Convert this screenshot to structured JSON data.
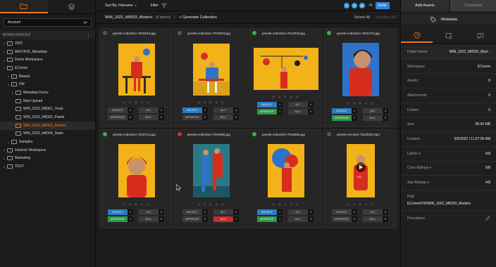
{
  "sidebar": {
    "account_label": "Account",
    "workspaces_header": "WORKSPACES",
    "tree": [
      {
        "label": "2022",
        "depth": 0,
        "arrow": "▸"
      },
      {
        "label": "ARCHIVE_Metadata",
        "depth": 0,
        "arrow": "▸"
      },
      {
        "label": "Demo Workspace",
        "depth": 0,
        "arrow": "▸"
      },
      {
        "label": "EComm",
        "depth": 0,
        "arrow": "▾"
      },
      {
        "label": "Beauty",
        "depth": 1,
        "arrow": "▸"
      },
      {
        "label": "FW",
        "depth": 1,
        "arrow": "▾"
      },
      {
        "label": "Metadata Demo",
        "depth": 2,
        "arrow": "▸"
      },
      {
        "label": "New Upload",
        "depth": 2,
        "arrow": ""
      },
      {
        "label": "WIN_2022_M8301_Tonal",
        "depth": 2,
        "arrow": ""
      },
      {
        "label": "WIN_2022_M8302_Pastel",
        "depth": 2,
        "arrow": ""
      },
      {
        "label": "WIN_2022_M8303_Modern",
        "depth": 2,
        "arrow": "",
        "selected": true
      },
      {
        "label": "WIN_2022_M8304_Swim",
        "depth": 2,
        "arrow": ""
      },
      {
        "label": "Samples",
        "depth": 1,
        "arrow": "▸"
      },
      {
        "label": "Interiors Workspace",
        "depth": 0,
        "arrow": "▸"
      },
      {
        "label": "Marketing",
        "depth": 0,
        "arrow": "▸"
      },
      {
        "label": "TEST",
        "depth": 0,
        "arrow": "▸"
      }
    ]
  },
  "toolbar": {
    "sort_label": "Sort By: Filename",
    "filter_label": "Filter"
  },
  "collection": {
    "name": "WIN_2022_M8303_Modern",
    "count": "(8 items)",
    "generate": "+ Generate Collection",
    "select_all": "Select All",
    "deselect_all": "Deselect All"
  },
  "labels": {
    "select": "SELECT",
    "alt": "ALT",
    "approve": "APPROVE",
    "kill": "KILL"
  },
  "cards": [
    {
      "filename": "pexels-cottonbro-7510010.jpg",
      "dot": "#555555",
      "select": "0",
      "alt": "0",
      "approve": "0",
      "kill": "0",
      "active": []
    },
    {
      "filename": "pexels-cottonbro-7510023.jpg",
      "dot": "#555555",
      "select": "1",
      "alt": "0",
      "approve": "0",
      "kill": "0",
      "active": [
        "select"
      ]
    },
    {
      "filename": "pexels-cottonbro-7510026.jpg",
      "dot": "#3fae4a",
      "select": "1",
      "alt": "0",
      "approve": "1",
      "kill": "0",
      "active": [
        "select",
        "approve"
      ]
    },
    {
      "filename": "pexels-cottonbro-7515724.jpg",
      "dot": "#3fae4a",
      "select": "1",
      "alt": "0",
      "approve": "1",
      "kill": "0",
      "active": [
        "select",
        "approve"
      ]
    },
    {
      "filename": "pexels-cottonbro-7515731.jpg",
      "dot": "#3fae4a",
      "select": "1",
      "alt": "0",
      "approve": "1",
      "kill": "0",
      "active": [
        "select",
        "approve"
      ]
    },
    {
      "filename": "pexels-cottonbro-7516565.jpg",
      "dot": "#d03232",
      "select": "0",
      "alt": "0",
      "approve": "0",
      "kill": "1",
      "active": [
        "kill"
      ]
    },
    {
      "filename": "pexels-cottonbro-7516566.jpg",
      "dot": "#3fae4a",
      "select": "1",
      "alt": "0",
      "approve": "1",
      "kill": "0",
      "active": [
        "select",
        "approve"
      ]
    },
    {
      "filename": "pexels-ron-lach-7510038.mp4",
      "dot": "#555555",
      "select": "0",
      "alt": "0",
      "approve": "0",
      "kill": "0",
      "active": [],
      "video_badge": "100"
    }
  ],
  "topbar": {
    "avatars": [
      "T",
      "F",
      "R"
    ],
    "more": "+5",
    "invite": "Invite",
    "add_assets": "Add Assets",
    "download": "Download"
  },
  "metadata": {
    "title": "Metadata",
    "rows": [
      {
        "key": "Folder Name",
        "value": "WIN_2022_M8303_Mod..."
      },
      {
        "key": "Workspace",
        "value": "EComm"
      },
      {
        "key": "Assets",
        "value": "8"
      },
      {
        "key": "Attachments",
        "value": "0"
      },
      {
        "key": "Folders",
        "value": "0"
      },
      {
        "key": "Size",
        "value": "90.65 MB"
      },
      {
        "key": "Created",
        "value": "5/5/2022 | 11:27:55 AM"
      },
      {
        "key": "Labels ▾",
        "value": "6/8"
      },
      {
        "key": "Color Ratings ▾",
        "value": "5/8"
      },
      {
        "key": "Star Ratings ▾",
        "value": "4/8"
      }
    ],
    "path_key": "Path",
    "path_value": "EComm/FW/WIN_2022_M8303_Modern",
    "description_key": "Description"
  },
  "colors": {
    "accent": "#f07c1a",
    "select_blue": "#2a7bc4",
    "approve_green": "#2e9a48",
    "kill_red": "#c42e2e",
    "invite_blue": "#2f86d6"
  }
}
